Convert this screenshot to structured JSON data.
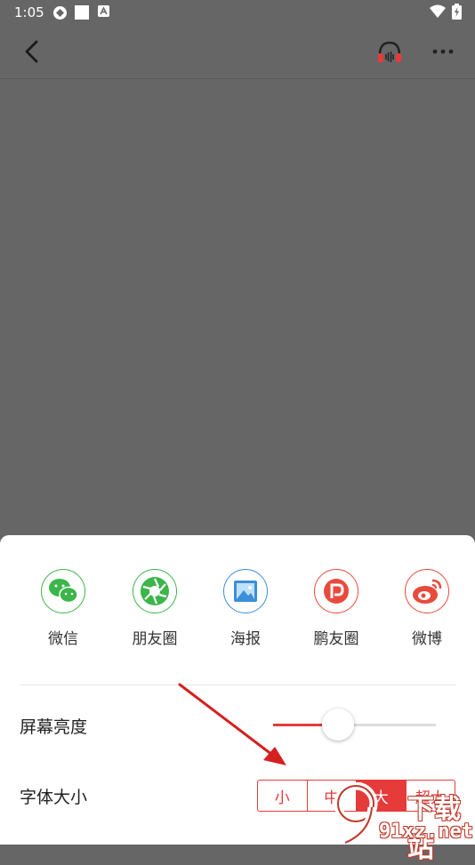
{
  "status_bar": {
    "time": "1:05",
    "icons": [
      "sync-icon",
      "square-icon",
      "a-icon",
      "wifi-icon",
      "battery-icon"
    ]
  },
  "topbar": {
    "back_icon": "back-chevron-icon",
    "audio_icon": "headphones-icon",
    "more_icon": "more-icon"
  },
  "share": {
    "items": [
      {
        "label": "微信",
        "icon": "wechat-icon",
        "color": "#3cb54a"
      },
      {
        "label": "朋友圈",
        "icon": "moments-icon",
        "color": "#3cb54a"
      },
      {
        "label": "海报",
        "icon": "poster-icon",
        "color": "#3b8fd9"
      },
      {
        "label": "鹏友圈",
        "icon": "pengyouquan-icon",
        "color": "#e84a3c"
      },
      {
        "label": "微博",
        "icon": "weibo-icon",
        "color": "#e84a3c"
      }
    ]
  },
  "settings": {
    "brightness_label": "屏幕亮度",
    "brightness_value": 0.28,
    "font_size_label": "字体大小",
    "font_sizes": [
      "小",
      "中",
      "大",
      "超大"
    ],
    "font_size_selected": "大"
  },
  "watermark": {
    "top_text": "下载站",
    "bottom_text": "91xz.net"
  },
  "colors": {
    "accent": "#e63b3b",
    "overlay": "#666666"
  }
}
